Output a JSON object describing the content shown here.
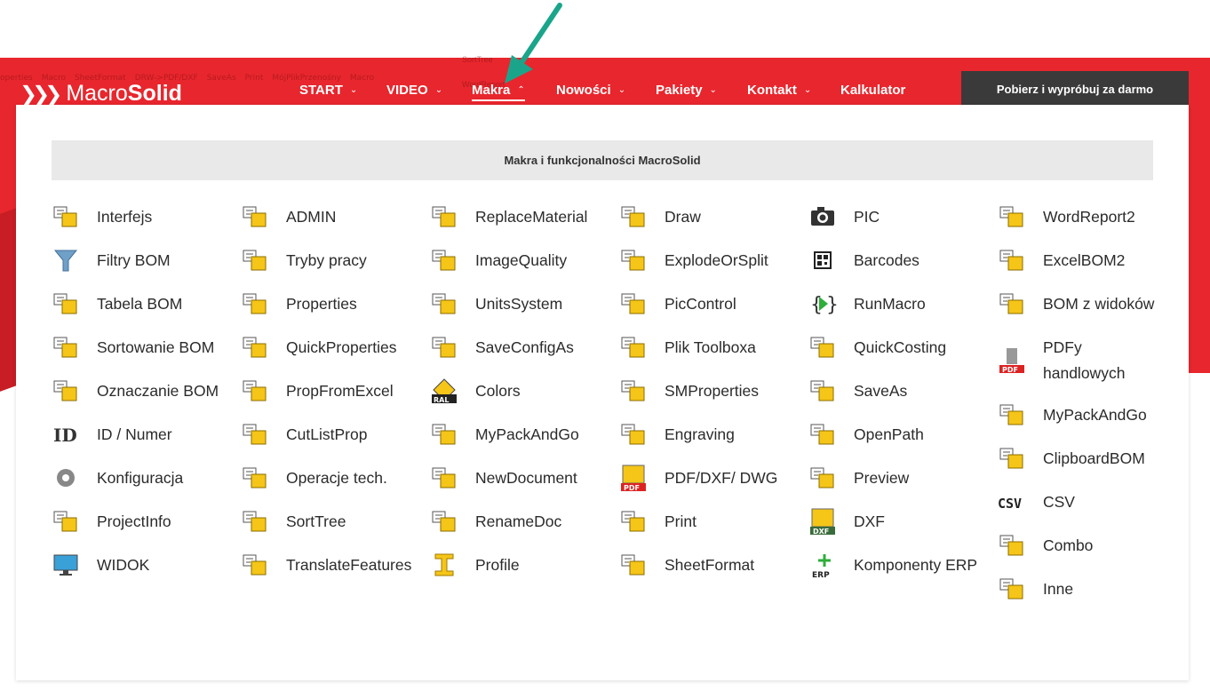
{
  "colors": {
    "brand_red": "#e8262d",
    "cta_bg": "#3a3a3a",
    "arrow": "#1aa58b",
    "panel_header_bg": "#e9e9e9"
  },
  "ghost_toolbar": [
    "operties",
    "Macro",
    "SheetFormat",
    "DRW->PDF/DXF",
    "SaveAs",
    "Print",
    "MójPlikPrzenośny",
    "Macro",
    "SortTree",
    "WordReport"
  ],
  "logo": {
    "part1": "Macro",
    "part2": "Solid"
  },
  "nav": {
    "items": [
      {
        "label": "START",
        "has_chevron": true,
        "active": false
      },
      {
        "label": "VIDEO",
        "has_chevron": true,
        "active": false
      },
      {
        "label": "Makra",
        "has_chevron": true,
        "active": true
      },
      {
        "label": "Nowości",
        "has_chevron": true,
        "active": false
      },
      {
        "label": "Pakiety",
        "has_chevron": true,
        "active": false
      },
      {
        "label": "Kontakt",
        "has_chevron": true,
        "active": false
      },
      {
        "label": "Kalkulator",
        "has_chevron": false,
        "active": false
      }
    ],
    "cta": "Pobierz i wypróbuj za darmo"
  },
  "panel": {
    "title": "Makra i funkcjonalności MacroSolid",
    "columns": [
      [
        {
          "label": "Interfejs",
          "icon": "interface-icon"
        },
        {
          "label": "Filtry BOM",
          "icon": "filter-icon"
        },
        {
          "label": "Tabela BOM",
          "icon": "table-gear-icon"
        },
        {
          "label": "Sortowanie BOM",
          "icon": "sort-icon"
        },
        {
          "label": "Oznaczanie BOM",
          "icon": "mark-table-icon"
        },
        {
          "label": "ID / Numer",
          "icon": "id-icon"
        },
        {
          "label": "Konfiguracja",
          "icon": "gear-icon"
        },
        {
          "label": "ProjectInfo",
          "icon": "project-icon"
        },
        {
          "label": "WIDOK",
          "icon": "monitor-icon"
        }
      ],
      [
        {
          "label": "ADMIN",
          "icon": "admin-icon"
        },
        {
          "label": "Tryby pracy",
          "icon": "modes-icon"
        },
        {
          "label": "Properties",
          "icon": "properties-icon"
        },
        {
          "label": "QuickProperties",
          "icon": "quick-properties-icon"
        },
        {
          "label": "PropFromExcel",
          "icon": "excel-props-icon"
        },
        {
          "label": "CutListProp",
          "icon": "cutlist-icon"
        },
        {
          "label": "Operacje tech.",
          "icon": "operations-icon"
        },
        {
          "label": "SortTree",
          "icon": "sort-tree-icon"
        },
        {
          "label": "TranslateFeatures",
          "icon": "translate-icon"
        }
      ],
      [
        {
          "label": "ReplaceMaterial",
          "icon": "replace-material-icon"
        },
        {
          "label": "ImageQuality",
          "icon": "image-quality-icon"
        },
        {
          "label": "UnitsSystem",
          "icon": "units-icon"
        },
        {
          "label": "SaveConfigAs",
          "icon": "save-config-icon"
        },
        {
          "label": "Colors",
          "icon": "ral-icon"
        },
        {
          "label": "MyPackAndGo",
          "icon": "pack-icon"
        },
        {
          "label": "NewDocument",
          "icon": "new-document-icon"
        },
        {
          "label": "RenameDoc",
          "icon": "rename-icon"
        },
        {
          "label": "Profile",
          "icon": "profile-icon"
        }
      ],
      [
        {
          "label": "Draw",
          "icon": "draw-icon"
        },
        {
          "label": "ExplodeOrSplit",
          "icon": "explode-icon"
        },
        {
          "label": "PicControl",
          "icon": "pic-control-icon"
        },
        {
          "label": "Plik Toolboxa",
          "icon": "toolbox-icon"
        },
        {
          "label": "SMProperties",
          "icon": "sheetmetal-icon"
        },
        {
          "label": "Engraving",
          "icon": "engraving-icon"
        },
        {
          "label": "PDF/DXF/ DWG",
          "icon": "pdf-icon"
        },
        {
          "label": "Print",
          "icon": "printer-icon"
        },
        {
          "label": "SheetFormat",
          "icon": "sheet-format-icon"
        }
      ],
      [
        {
          "label": "PIC",
          "icon": "camera-icon"
        },
        {
          "label": "Barcodes",
          "icon": "qr-icon"
        },
        {
          "label": "RunMacro",
          "icon": "run-macro-icon"
        },
        {
          "label": "QuickCosting",
          "icon": "costing-icon"
        },
        {
          "label": "SaveAs",
          "icon": "save-as-icon"
        },
        {
          "label": "OpenPath",
          "icon": "folder-icon"
        },
        {
          "label": "Preview",
          "icon": "preview-icon"
        },
        {
          "label": "DXF",
          "icon": "dxf-icon"
        },
        {
          "label": "Komponenty ERP",
          "icon": "erp-icon"
        }
      ],
      [
        {
          "label": "WordReport2",
          "icon": "word-icon"
        },
        {
          "label": "ExcelBOM2",
          "icon": "excel-icon"
        },
        {
          "label": "BOM z widoków",
          "icon": "bom-views-icon"
        },
        {
          "label": "PDFy handlowych",
          "icon": "pdf-part-icon"
        },
        {
          "label": "MyPackAndGo",
          "icon": "dxf-pdf-pack-icon"
        },
        {
          "label": "ClipboardBOM",
          "icon": "clipboard-icon"
        },
        {
          "label": "CSV",
          "icon": "csv-icon"
        },
        {
          "label": "Combo",
          "icon": "combo-icon"
        },
        {
          "label": "Inne",
          "icon": "other-icon"
        }
      ]
    ]
  }
}
